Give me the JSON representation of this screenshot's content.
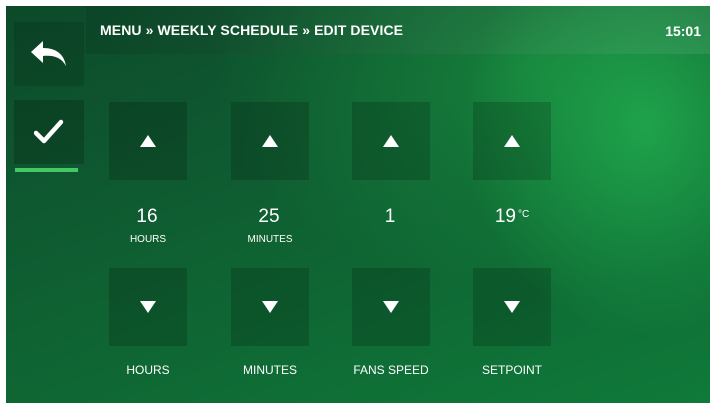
{
  "header": {
    "breadcrumb": "MENU » WEEKLY SCHEDULE » EDIT DEVICE",
    "time": "15:01"
  },
  "icons": {
    "back": "back-arrow-icon",
    "confirm": "checkmark-icon",
    "up": "triangle-up-icon",
    "down": "triangle-down-icon"
  },
  "colors": {
    "background": "#0f6633",
    "accent": "#43c964",
    "text": "#ffffff"
  },
  "controls": [
    {
      "value": "16",
      "unit": "",
      "sublabel": "HOURS",
      "label": "HOURS"
    },
    {
      "value": "25",
      "unit": "",
      "sublabel": "MINUTES",
      "label": "MINUTES"
    },
    {
      "value": "1",
      "unit": "",
      "sublabel": "",
      "label": "FANS SPEED"
    },
    {
      "value": "19",
      "unit": "°C",
      "sublabel": "",
      "label": "SETPOINT"
    }
  ]
}
